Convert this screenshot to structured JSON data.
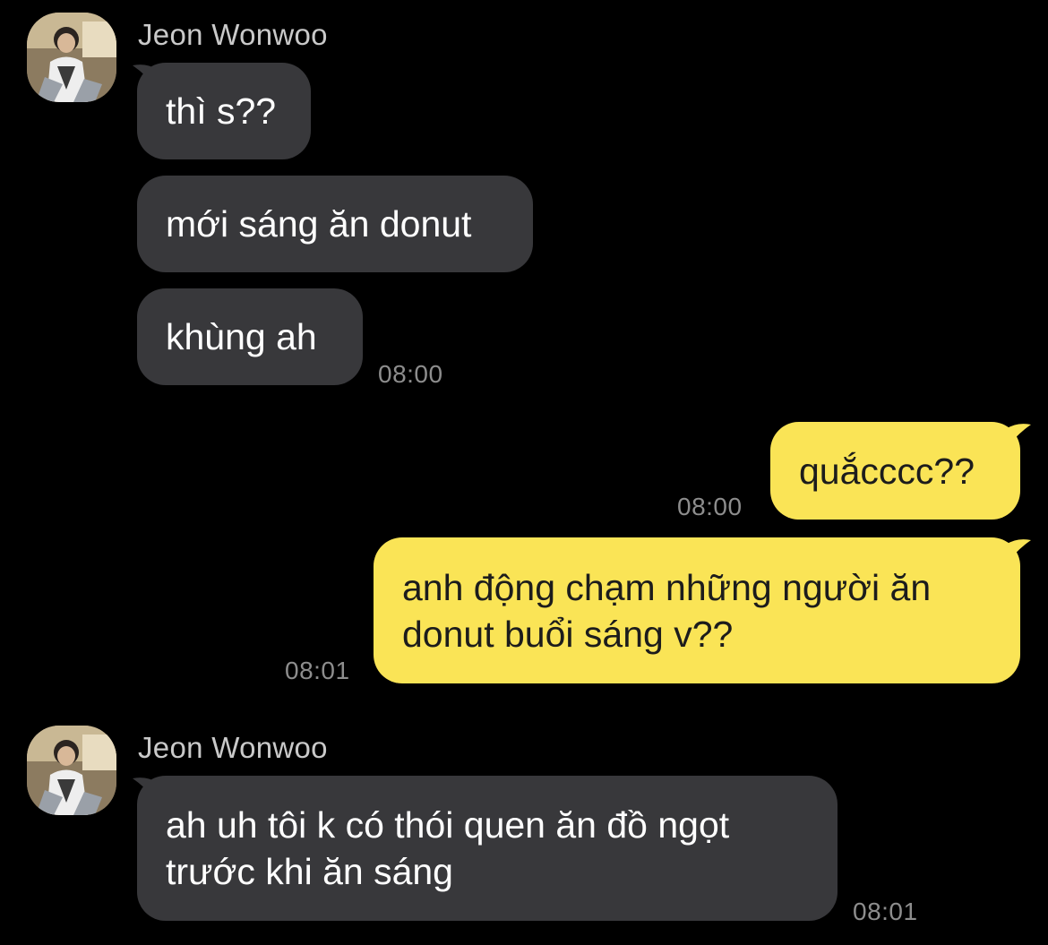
{
  "colors": {
    "background": "#000000",
    "incoming_bubble": "#38383b",
    "outgoing_bubble": "#fae456",
    "timestamp": "#8d8d8d",
    "sender_name": "#c9c9c9"
  },
  "groups": [
    {
      "sender": "Jeon Wonwoo",
      "avatar_icon": "profile-photo-icon",
      "messages": [
        {
          "text": "thì s??"
        },
        {
          "text": "mới sáng ăn donut"
        },
        {
          "text": "khùng ah"
        }
      ],
      "time": "08:00"
    },
    {
      "sender": "me",
      "messages": [
        {
          "text": "quắcccc??",
          "time": "08:00"
        },
        {
          "text": "anh động chạm những người ăn\ndonut buổi sáng v??",
          "time": "08:01"
        }
      ]
    },
    {
      "sender": "Jeon Wonwoo",
      "avatar_icon": "profile-photo-icon",
      "messages": [
        {
          "text": "ah uh tôi k có thói quen ăn đồ ngọt\ntrước khi ăn sáng"
        }
      ],
      "time": "08:01"
    }
  ]
}
